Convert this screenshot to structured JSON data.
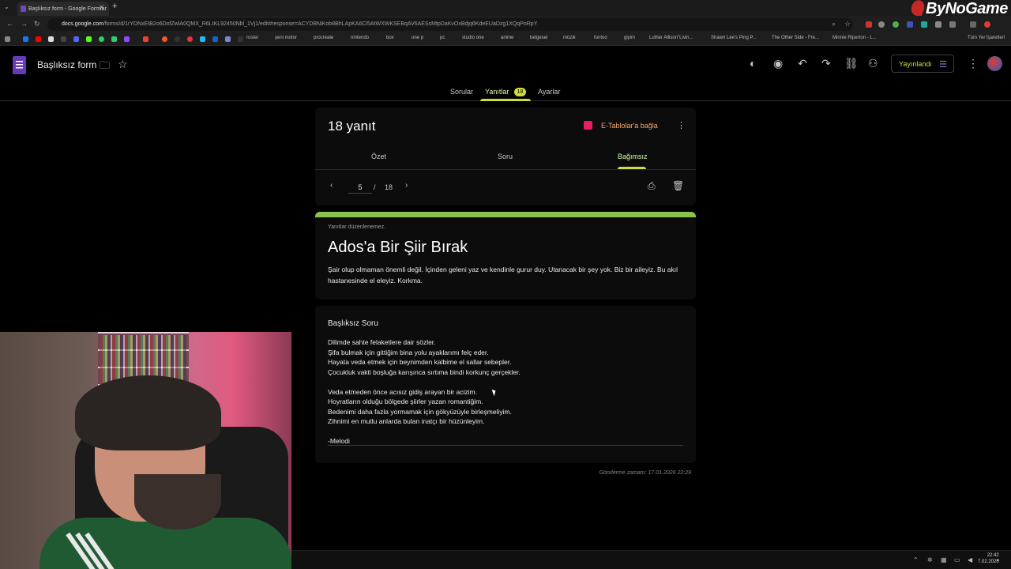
{
  "browser": {
    "tab_title": "Başlıksız form - Google Formlar",
    "url_host": "docs.google.com",
    "url_path": "/forms/d/1rYDNxEtB2o6DofZwlA0QMX_R6LtKL92450Nbl_1Vj1/edit#response=ACYDBNiKob8BhLApKA6Cl5AtWXWKSEBqAV6AESsMtpDaKvOxBdjq6KdeEUaDzg1XQqPoRpY",
    "overlay_brand": "ByNoGame",
    "bookmarks": [
      "roster",
      "yeni motor",
      "procreate",
      "nintendo",
      "box",
      "one p",
      "pc",
      "studio one",
      "anime",
      "belgesel",
      "müzik",
      "fontoo",
      "giyim",
      "Luther Allison\"Livin...",
      "Shawn Lee's Ping P...",
      "The Other Side - Fre...",
      "Minnie Riperton - L...",
      "Tüm Yer İşaretleri"
    ]
  },
  "header": {
    "form_title": "Başlıksız form",
    "publish_label": "Yayınlandı"
  },
  "main_tabs": {
    "questions": "Sorular",
    "responses": "Yanıtlar",
    "responses_count": "18",
    "settings": "Ayarlar"
  },
  "responses": {
    "count_label": "18 yanıt",
    "sheets_link": "E-Tablolar'a bağla",
    "subtabs": {
      "summary": "Özet",
      "question": "Soru",
      "individual": "Bağımsız"
    },
    "pager": {
      "current": "5",
      "separator": "/",
      "total": "18"
    }
  },
  "form": {
    "not_editable": "Yanıtlar düzenlenemez.",
    "heading": "Ados'a Bir Şiir Bırak",
    "description": "Şair olup olmaman önemli değil. İçinden geleni yaz ve kendinle gurur duy. Utanacak bir şey yok. Biz bir aileyiz. Bu akıl hastanesinde el eleyiz. Korkma."
  },
  "answer": {
    "question_title": "Başlıksız Soru",
    "lines": [
      "Dilimde sahte felaketlere dair sözler.",
      "Şifa bulmak için gittiğim bina yolu ayaklarımı felç eder.",
      "Hayata veda etmek için beynimden kalbime el sallar sebepler.",
      "Çocukluk vakti boşluğa karışınca sırtıma bindi korkunç gerçekler.",
      "",
      "Veda etmeden önce acısız gidiş arayan bir acizim.",
      "Hoyratların olduğu bölgede şiirler yazan romantiğim.",
      "Bedenimi daha fazla yormamak için gökyüzüyle birleşmeliyim.",
      "Zihnimi en mutlu anlarda bulan inatçı bir hüzünleyim.",
      "",
      "-Melodi"
    ],
    "submitted_at": "Gönderme zamanı: 17.01.2026 22:29"
  },
  "taskbar": {
    "time": "22:42",
    "date": "7.02.2026"
  },
  "colors": {
    "accent_green": "#8bc34a",
    "tab_highlight": "#cddc39",
    "form_purple": "#673ab7",
    "sheets_pink": "#e91e63"
  }
}
